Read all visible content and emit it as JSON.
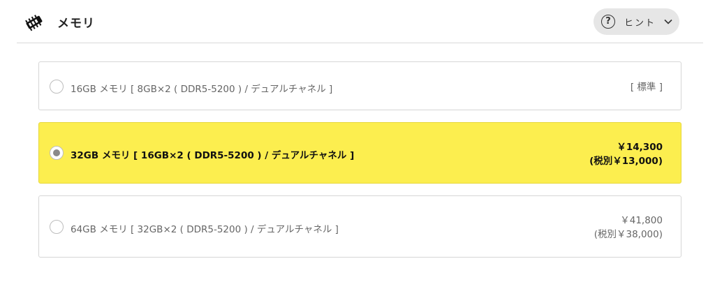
{
  "section": {
    "title": "メモリ",
    "icon": "memory-chip-icon"
  },
  "hint": {
    "icon_char": "?",
    "label": "ヒント",
    "chevron": "chevron-down-icon"
  },
  "options": [
    {
      "label": "16GB メモリ [ 8GB×2 ( DDR5-5200 ) / デュアルチャネル ]",
      "price": "[ 標準 ]",
      "tax_excluded": "",
      "selected": false
    },
    {
      "label": "32GB メモリ [ 16GB×2 ( DDR5-5200 ) / デュアルチャネル ]",
      "price": "￥14,300",
      "tax_excluded": "(税別￥13,000)",
      "selected": true
    },
    {
      "label": "64GB メモリ [ 32GB×2 ( DDR5-5200 ) / デュアルチャネル ]",
      "price": "￥41,800",
      "tax_excluded": "(税別￥38,000)",
      "selected": false
    }
  ],
  "colors": {
    "selected_bg": "#fcee4f",
    "border": "#d6d6d6",
    "hint_bg": "#e6e6e6"
  }
}
